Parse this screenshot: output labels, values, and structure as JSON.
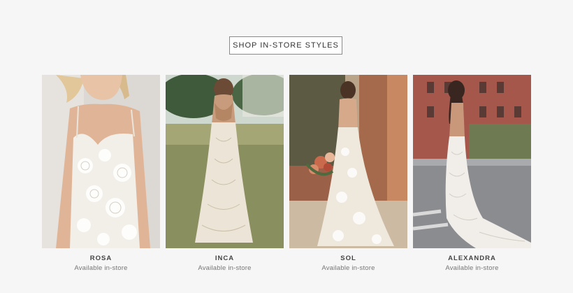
{
  "cta": {
    "label": "SHOP IN-STORE STYLES"
  },
  "products": [
    {
      "name": "ROSA",
      "status": "Available in-store"
    },
    {
      "name": "INCA",
      "status": "Available in-store"
    },
    {
      "name": "SOL",
      "status": "Available in-store"
    },
    {
      "name": "ALEXANDRA",
      "status": "Available in-store"
    }
  ]
}
